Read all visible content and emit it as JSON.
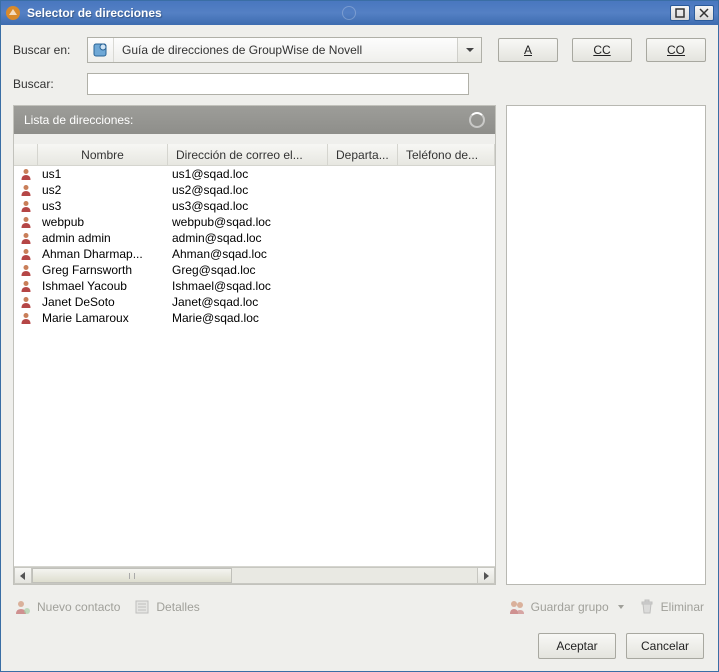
{
  "window": {
    "title": "Selector de direcciones"
  },
  "labels": {
    "search_in": "Buscar en:",
    "search": "Buscar:",
    "address_list": "Lista de direcciones:"
  },
  "combo": {
    "selected": "Guía de direcciones de GroupWise de Novell"
  },
  "recipient_buttons": {
    "to": "A",
    "cc": "CC",
    "bcc": "CO"
  },
  "search": {
    "value": "",
    "placeholder": ""
  },
  "columns": {
    "name": "Nombre",
    "email": "Dirección de correo el...",
    "department": "Departa...",
    "phone": "Teléfono de..."
  },
  "rows": [
    {
      "name": "us1",
      "email": "us1@sqad.loc"
    },
    {
      "name": "us2",
      "email": "us2@sqad.loc"
    },
    {
      "name": "us3",
      "email": "us3@sqad.loc"
    },
    {
      "name": "webpub",
      "email": "webpub@sqad.loc"
    },
    {
      "name": "admin admin",
      "email": "admin@sqad.loc"
    },
    {
      "name": "Ahman Dharmap...",
      "email": "Ahman@sqad.loc"
    },
    {
      "name": "Greg Farnsworth",
      "email": "Greg@sqad.loc"
    },
    {
      "name": "Ishmael Yacoub",
      "email": "Ishmael@sqad.loc"
    },
    {
      "name": "Janet DeSoto",
      "email": "Janet@sqad.loc"
    },
    {
      "name": "Marie Lamaroux",
      "email": "Marie@sqad.loc"
    }
  ],
  "toolbar": {
    "new_contact": "Nuevo contacto",
    "details": "Detalles",
    "save_group": "Guardar grupo",
    "delete": "Eliminar"
  },
  "footer": {
    "ok": "Aceptar",
    "cancel": "Cancelar"
  }
}
